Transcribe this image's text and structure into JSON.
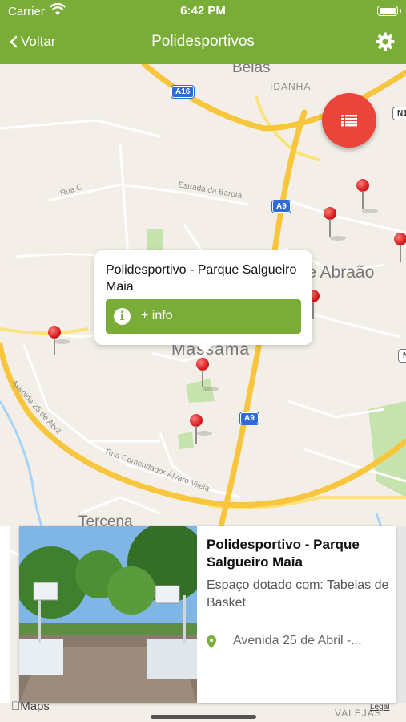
{
  "status_bar": {
    "carrier": "Carrier",
    "time": "6:42 PM"
  },
  "nav": {
    "back_label": "Voltar",
    "title": "Polidesportivos",
    "settings_icon": "gear-icon"
  },
  "map": {
    "labels": {
      "belas": "Belas",
      "idanha": "IDANHA",
      "rua_c": "Rua C",
      "estrada_barota": "Estrada da Barota",
      "ponte_abraao": "Ponte Abraão",
      "massama": "Massama",
      "avenida_25": "Avenida 25 de Abril",
      "rua_comendador": "Rua Comendador Álvaro Vilela",
      "tercena": "Tercena",
      "valejas": "VALEJAS"
    },
    "road_badges": {
      "a16": "A16",
      "a9_top": "A9",
      "a9_bottom": "A9",
      "n1": "N1",
      "n_right": "N"
    }
  },
  "fab": {
    "icon": "list-icon"
  },
  "callout": {
    "title": "Polidesportivo - Parque Salgueiro Maia",
    "info_label": "+ info",
    "info_icon": "i"
  },
  "card": {
    "name": "Polidesportivo - Parque Salgueiro Maia",
    "description": "Espaço dotado com: Tabelas de Basket",
    "address": "Avenida 25 de Abril -..."
  },
  "footer": {
    "maps_label": "Maps",
    "legal_label": "Legal"
  },
  "colors": {
    "brand_green": "#7aad38",
    "fab_red": "#e9453a",
    "pin_red": "#d61c1c"
  }
}
